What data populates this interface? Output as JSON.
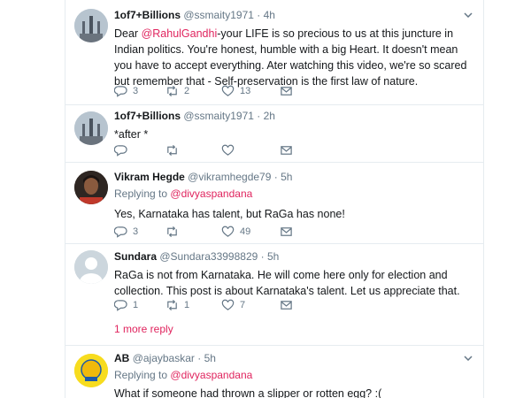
{
  "tweets": [
    {
      "name": "1of7+Billions",
      "handle": "@ssmaity1971",
      "time": "· 4h",
      "text_before": "Dear ",
      "mention": "@RahulGandhi",
      "text_after": "-your LIFE is so precious to us at this juncture in Indian politics. You're honest, humble with a big Heart. It doesn't mean you have to accept everything. Ater watching this video, we're so scared but remember that - Self-preservation is the first law of nature.",
      "replies": "3",
      "retweets": "2",
      "likes": "13"
    },
    {
      "name": "1of7+Billions",
      "handle": "@ssmaity1971",
      "time": "· 2h",
      "text": "*after *"
    },
    {
      "name": "Vikram Hegde",
      "handle": "@vikramhegde79",
      "time": "· 5h",
      "replying_label": "Replying to",
      "replying_to": "@divyaspandana",
      "text": "Yes, Karnataka has talent, but RaGa has none!",
      "replies": "3",
      "likes": "49"
    },
    {
      "name": "Sundara",
      "handle": "@Sundara33998829",
      "time": "· 5h",
      "text": "RaGa is not from Karnataka. He will come here only for election and collection. This post is about Karnataka's talent. Let us appreciate that.",
      "replies": "1",
      "retweets": "1",
      "likes": "7"
    },
    {
      "name": "AB",
      "handle": "@ajaybaskar",
      "time": "· 5h",
      "replying_label": "Replying to",
      "replying_to": "@divyaspandana",
      "text": "What if someone had thrown a slipper or rotten egg? :("
    }
  ],
  "more_replies": "1 more reply",
  "colors": {
    "accent": "#e0245e",
    "muted": "#657786",
    "border": "#e6ecf0"
  },
  "icons": [
    "reply-icon",
    "retweet-icon",
    "like-icon",
    "message-icon",
    "chevron-down-icon"
  ]
}
